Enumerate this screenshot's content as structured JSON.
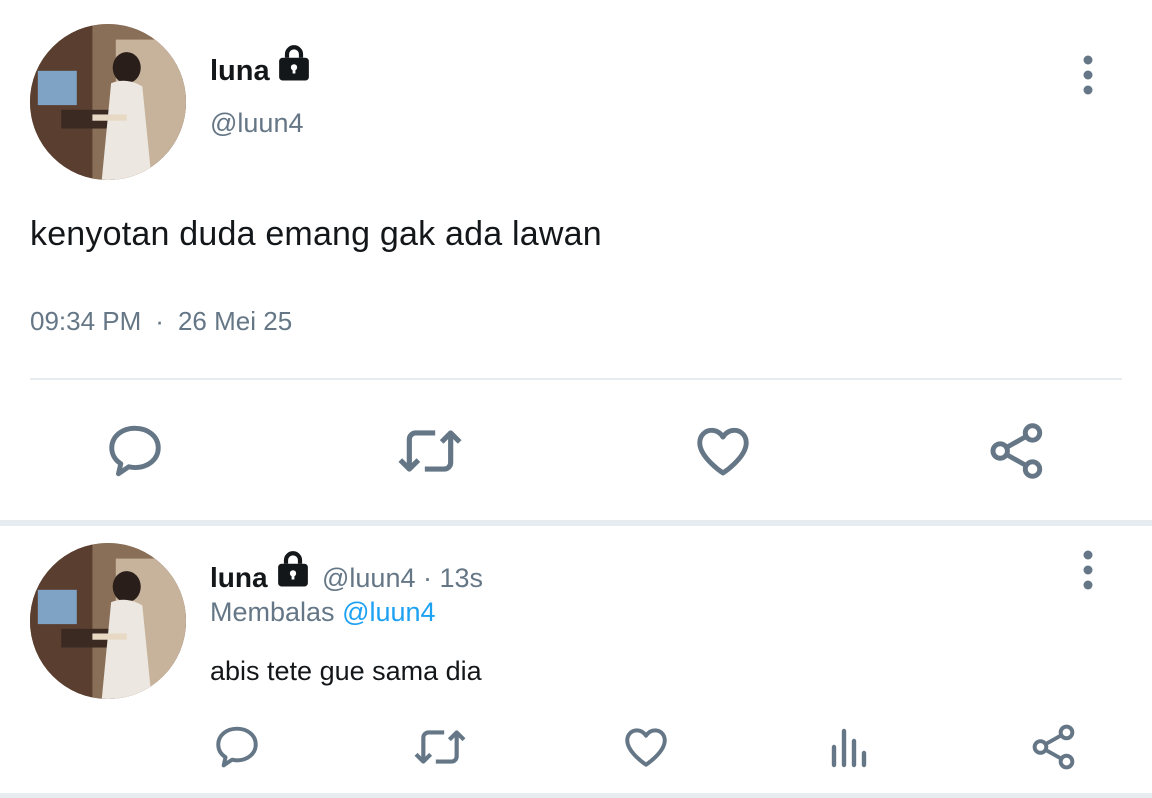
{
  "main_tweet": {
    "display_name": "luna",
    "handle": "@luun4",
    "text": "kenyotan duda emang gak ada lawan",
    "time": "09:34 PM",
    "separator": "·",
    "date": "26 Mei 25",
    "icons": [
      "lock-icon",
      "more-vertical-icon",
      "reply-icon",
      "retweet-icon",
      "like-icon",
      "share-icon"
    ]
  },
  "reply_tweet": {
    "display_name": "luna",
    "handle_time": "@luun4 · 13s",
    "replying_label": "Membalas",
    "replying_to": "@luun4",
    "text": "abis tete gue sama dia",
    "icons": [
      "lock-icon",
      "more-vertical-icon",
      "reply-icon",
      "retweet-icon",
      "like-icon",
      "views-icon",
      "share-icon"
    ]
  },
  "colors": {
    "text_primary": "#14171a",
    "text_secondary": "#657786",
    "icon": "#657786",
    "mention": "#1da1f2",
    "divider": "#e6ecf0"
  }
}
